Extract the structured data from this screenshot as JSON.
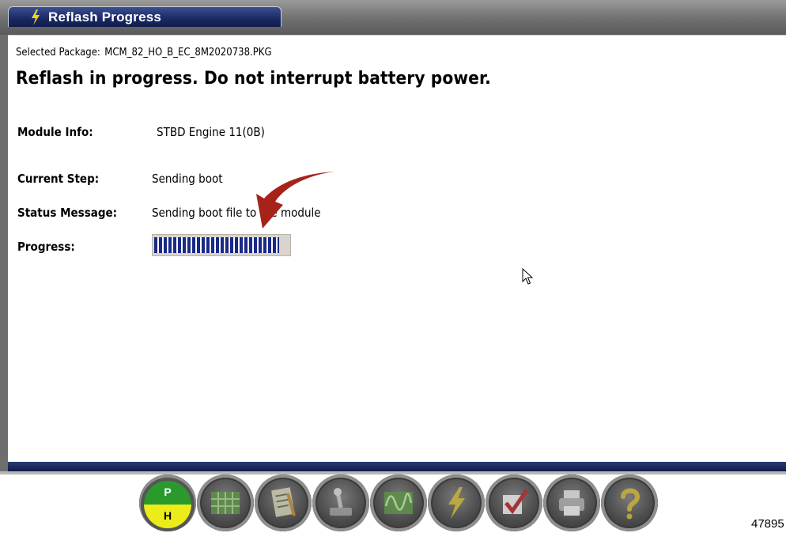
{
  "window": {
    "title": "Reflash Progress",
    "title_icon": "lightning-icon"
  },
  "package": {
    "label": "Selected Package:",
    "value": "MCM_82_HO_B_EC_8M2020738.PKG"
  },
  "warning": "Reflash in progress. Do not interrupt battery power.",
  "fields": {
    "module_info": {
      "label": "Module Info:",
      "value": "STBD Engine  11(0B)"
    },
    "current_step": {
      "label": "Current Step:",
      "value": "Sending boot"
    },
    "status_message": {
      "label": "Status Message:",
      "value": "Sending boot file to the module"
    },
    "progress": {
      "label": "Progress:",
      "fraction": 0.93
    }
  },
  "colors": {
    "title_bar": "#1a2862",
    "progress_fill": "#1a2a86",
    "callout_arrow": "#a7221a",
    "ph_top": "#2a9a2c",
    "ph_bottom": "#ecec1a"
  },
  "toolbar": {
    "ph_top_letter": "P",
    "ph_bottom_letter": "H",
    "buttons": [
      "ph-indicator",
      "data-grid-icon",
      "checklist-icon",
      "joystick-icon",
      "waveform-icon",
      "reflash-icon",
      "checkbox-icon",
      "printer-icon",
      "help-icon"
    ]
  },
  "figure_id": "47895"
}
